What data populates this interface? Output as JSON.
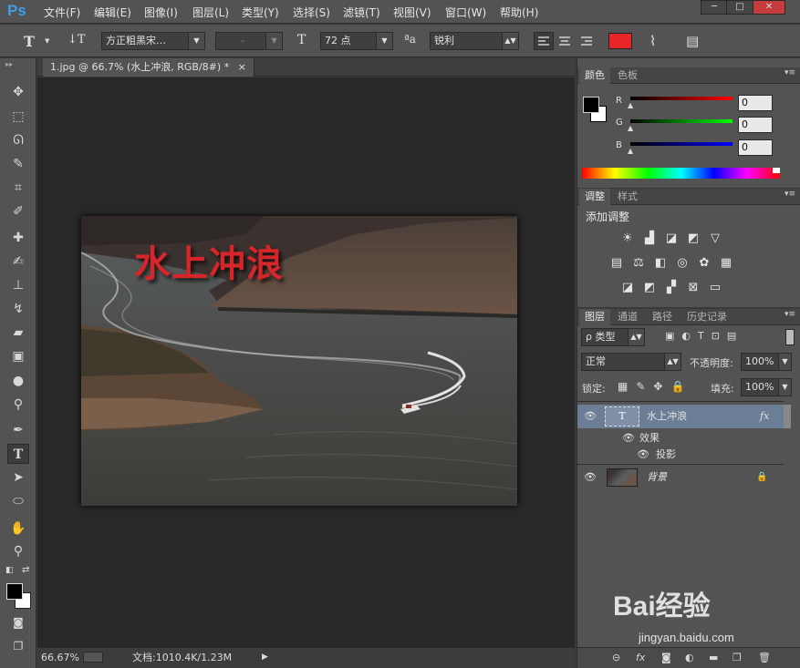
{
  "app": {
    "logo": "Ps"
  },
  "menu": [
    "文件(F)",
    "编辑(E)",
    "图像(I)",
    "图层(L)",
    "类型(Y)",
    "选择(S)",
    "滤镜(T)",
    "视图(V)",
    "窗口(W)",
    "帮助(H)"
  ],
  "window_controls": {
    "minimize": "─",
    "maximize": "□",
    "close": "✕"
  },
  "options": {
    "tool_glyph": "T",
    "orientation_glyph": "↓T",
    "font_family": "方正粗黑宋…",
    "font_style": "-",
    "size_glyph": "T",
    "font_size": "72 点",
    "aa_glyph": "ªa",
    "antialias": "锐利",
    "text_color": "#e8262a",
    "warp_glyph": "⌇",
    "panel_glyph": "▤"
  },
  "document": {
    "tab_title": "1.jpg @ 66.7% (水上冲浪, RGB/8#) *",
    "tab_close": "×",
    "text_layer": "水上冲浪"
  },
  "status": {
    "zoom": "66.67%",
    "doc_size": "文档:1010.4K/1.23M",
    "arrow": "▶"
  },
  "color_panel": {
    "tabs": [
      "颜色",
      "色板"
    ],
    "channels": [
      {
        "label": "R",
        "value": "0"
      },
      {
        "label": "G",
        "value": "0"
      },
      {
        "label": "B",
        "value": "0"
      }
    ],
    "foreground": "#000000",
    "background": "#ffffff"
  },
  "adjustments_panel": {
    "tabs": [
      "调整",
      "样式"
    ],
    "title": "添加调整"
  },
  "layers_panel": {
    "tabs": [
      "图层",
      "通道",
      "路径",
      "历史记录"
    ],
    "filter": "ρ 类型",
    "blend_mode": "正常",
    "opacity_label": "不透明度:",
    "opacity": "100%",
    "lock_label": "锁定:",
    "fill_label": "填充:",
    "fill": "100%",
    "layers": [
      {
        "name": "水上冲浪",
        "fx": "fx"
      },
      {
        "name": "效果"
      },
      {
        "name": "投影"
      },
      {
        "name": "背景",
        "lock": "🔒"
      }
    ],
    "bottom_icons": [
      "⊝",
      "fx",
      "◙",
      "◐",
      "▬",
      "❐",
      "🗑"
    ]
  },
  "watermark": {
    "brand": "Bai经验",
    "url": "jingyan.baidu.com"
  }
}
